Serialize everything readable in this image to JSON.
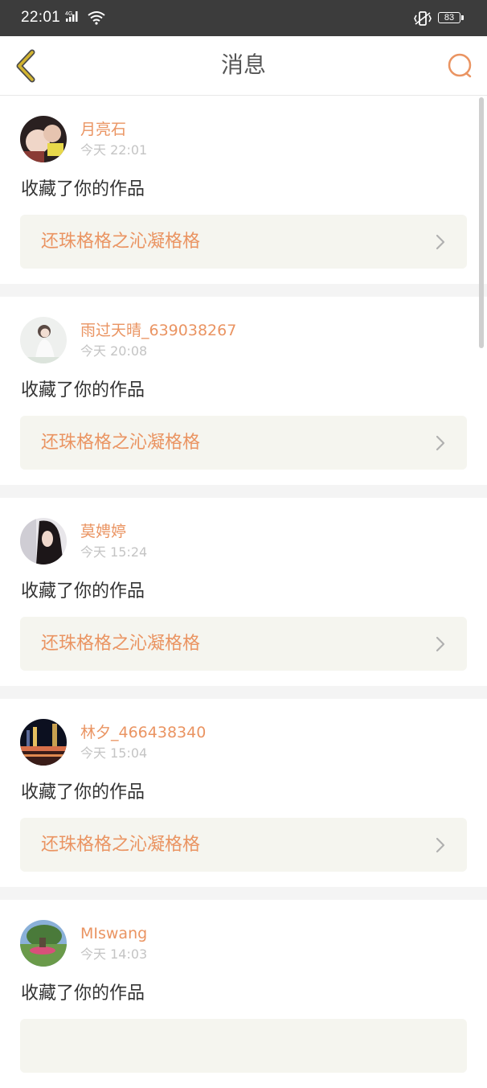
{
  "status_bar": {
    "time": "22:01",
    "network": "4G",
    "battery": "83",
    "icons": [
      "signal-icon",
      "wifi-icon",
      "vibrate-icon",
      "battery-icon"
    ]
  },
  "header": {
    "title": "消息",
    "back_icon": "back-chevron-icon",
    "search_icon": "search-icon"
  },
  "colors": {
    "accent": "#ea9462",
    "back_icon": "#d2b430",
    "card_bg": "#f5f5ef",
    "separator": "#f4f4f4"
  },
  "messages": [
    {
      "username": "月亮石",
      "time": "今天 22:01",
      "action": "收藏了你的作品",
      "work": "还珠格格之沁凝格格"
    },
    {
      "username": "雨过天晴_639038267",
      "time": "今天 20:08",
      "action": "收藏了你的作品",
      "work": "还珠格格之沁凝格格"
    },
    {
      "username": "莫娉婷",
      "time": "今天 15:24",
      "action": "收藏了你的作品",
      "work": "还珠格格之沁凝格格"
    },
    {
      "username": "林夕_466438340",
      "time": "今天 15:04",
      "action": "收藏了你的作品",
      "work": "还珠格格之沁凝格格"
    },
    {
      "username": "MIswang",
      "time": "今天 14:03",
      "action": "收藏了你的作品",
      "work": ""
    }
  ]
}
